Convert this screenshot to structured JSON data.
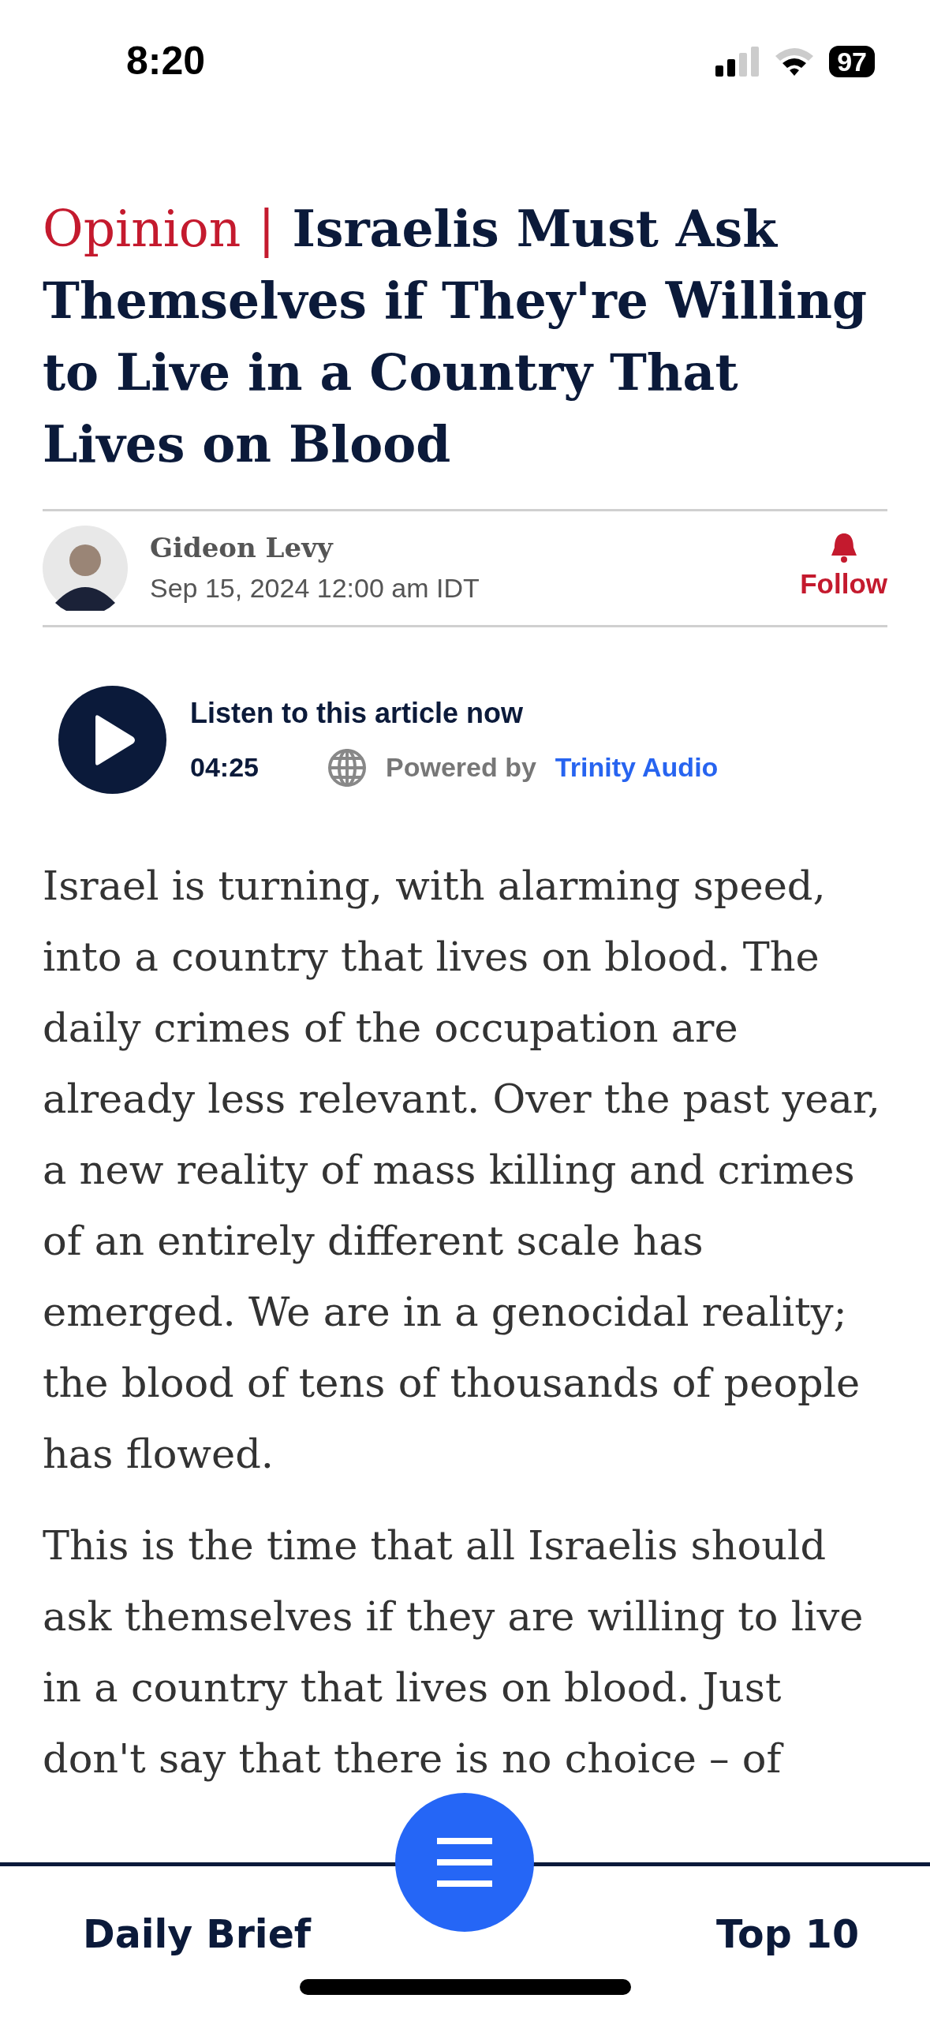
{
  "status_bar": {
    "time": "8:20",
    "battery": "97"
  },
  "article": {
    "section": "Opinion",
    "separator": "|",
    "headline": "Israelis Must Ask Themselves if They're Willing to Live in a Country That Lives on Blood",
    "author": {
      "name": "Gideon Levy",
      "date": "Sep 15, 2024 12:00 am IDT",
      "follow_label": "Follow"
    },
    "audio": {
      "title": "Listen to this article now",
      "duration": "04:25",
      "powered_by": "Powered by",
      "provider": "Trinity Audio"
    },
    "paragraphs": [
      "Israel is turning, with alarming speed, into a country that lives on blood. The daily crimes of the occupation are already less relevant. Over the past year, a new reality of mass killing and crimes of an entirely different scale has emerged. We are in a genocidal reality; the blood of tens of thousands of people has flowed.",
      "This is the time that all Israelis should ask themselves if they are willing to live in a country that lives on blood. Just don't say that there is no choice – of"
    ]
  },
  "bottom_nav": {
    "items": [
      {
        "label": "Daily Brief"
      },
      {
        "label": "Top 10"
      }
    ]
  }
}
